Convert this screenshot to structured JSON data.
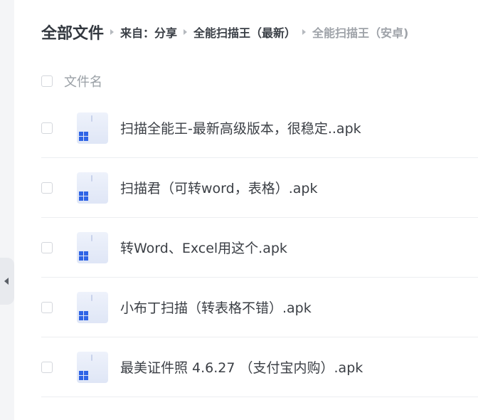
{
  "breadcrumb": {
    "root": "全部文件",
    "items": [
      "来自：分享",
      "全能扫描王（最新）"
    ],
    "current": "全能扫描王（安卓)"
  },
  "list": {
    "header_label": "文件名",
    "files": [
      {
        "name": "扫描全能王-最新高级版本，很稳定..apk",
        "icon": "apk-file-icon"
      },
      {
        "name": "扫描君（可转word，表格）.apk",
        "icon": "apk-file-icon"
      },
      {
        "name": "转Word、Excel用这个.apk",
        "icon": "apk-file-icon"
      },
      {
        "name": "小布丁扫描（转表格不错）.apk",
        "icon": "apk-file-icon"
      },
      {
        "name": "最美证件照 4.6.27 （支付宝内购）.apk",
        "icon": "apk-file-icon"
      }
    ]
  },
  "sidebar": {
    "collapse_icon": "chevron-left-icon"
  },
  "colors": {
    "text_primary": "#3b3f45",
    "text_muted": "#9ea2a8",
    "icon_accent": "#2f64e6",
    "divider": "#eceef1"
  }
}
